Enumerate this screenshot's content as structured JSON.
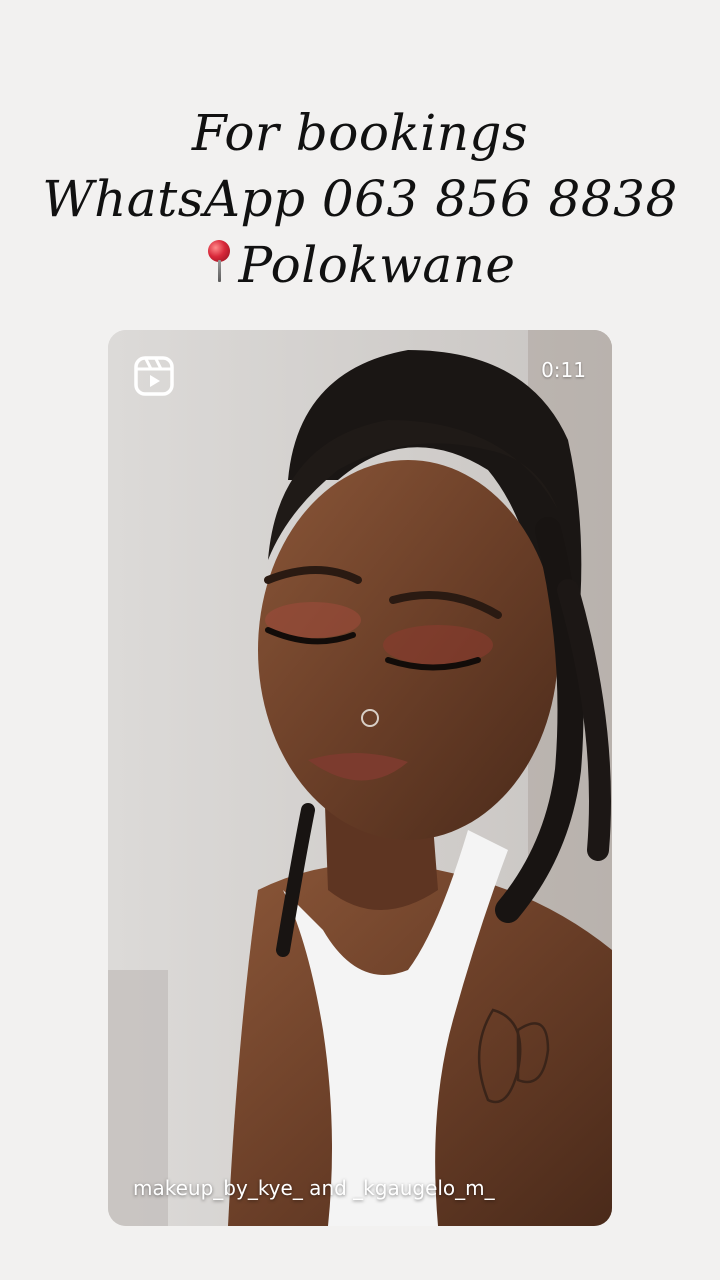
{
  "caption": {
    "line1": "For bookings",
    "line2": "WhatsApp 063 856 8838",
    "line3": "Polokwane"
  },
  "reel": {
    "icon": "reels-icon",
    "duration": "0:11",
    "credits": "makeup_by_kye_ and _kgaugelo_m_"
  },
  "colors": {
    "background": "#f2f1f0",
    "caption_text": "#111111",
    "overlay_text": "#ffffff",
    "pin": "#d8283a"
  }
}
